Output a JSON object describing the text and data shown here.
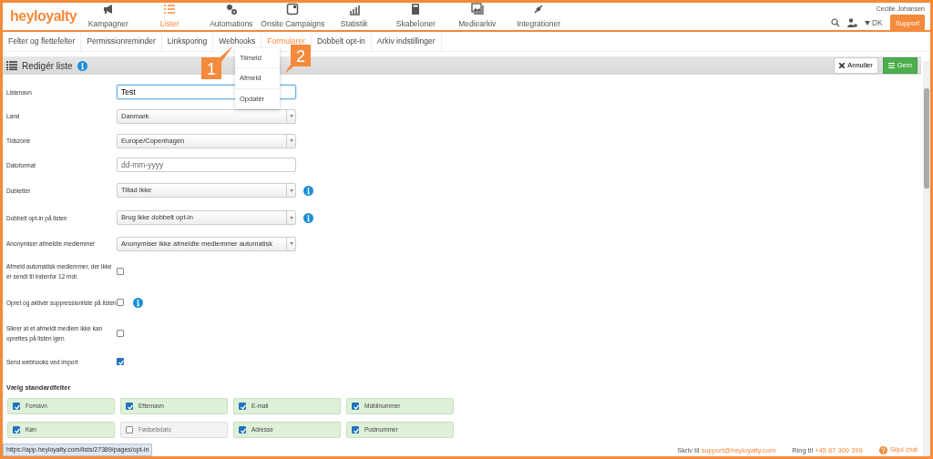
{
  "brand": "heyloyalty",
  "nav": [
    {
      "label": "Kampagner",
      "selected": false
    },
    {
      "label": "Lister",
      "selected": true
    },
    {
      "label": "Automations",
      "selected": false
    },
    {
      "label": "Onsite Campaigns",
      "selected": false
    },
    {
      "label": "Statistik",
      "selected": false
    },
    {
      "label": "Skabeloner",
      "selected": false
    },
    {
      "label": "Mediearkiv",
      "selected": false
    },
    {
      "label": "Integrationer",
      "selected": false
    }
  ],
  "user": {
    "name": "Cecilie Johansen",
    "language": "DK",
    "support": "Support"
  },
  "subnav": [
    {
      "label": "Felter og flettefelter",
      "selected": false
    },
    {
      "label": "Permissionreminder",
      "selected": false
    },
    {
      "label": "Linksporing",
      "selected": false
    },
    {
      "label": "Webhooks",
      "selected": false
    },
    {
      "label": "Formularer",
      "selected": true
    },
    {
      "label": "Dobbelt opt-in",
      "selected": false
    },
    {
      "label": "Arkiv indstillinger",
      "selected": false
    }
  ],
  "dropdown": [
    "Tilmeld",
    "Afmeld",
    "Opdatér"
  ],
  "callouts": [
    "1",
    "2"
  ],
  "panel": {
    "title": "Redigér liste",
    "cancel": "Annuller",
    "save": "Gem"
  },
  "form": [
    {
      "kind": "input",
      "label": "Listenavn",
      "value": "Test",
      "focused": true
    },
    {
      "kind": "select",
      "label": "Land",
      "value": "Danmark"
    },
    {
      "kind": "select",
      "label": "Tidszone",
      "value": "Europe/Copenhagen"
    },
    {
      "kind": "input",
      "label": "Datoformat",
      "placeholder": "dd-mm-yyyy",
      "focused": false
    },
    {
      "kind": "select",
      "label": "Dubletter",
      "value": "Tillad ikke",
      "info": true
    },
    {
      "kind": "select",
      "label": "Dobbelt opt-in på listen",
      "value": "Brug ikke dobbelt opt-in",
      "info": true
    },
    {
      "kind": "select",
      "label": "Anonymiser afmeldte medlemmer",
      "value": "Anonymiser ikke afmeldte medlemmer automatisk"
    },
    {
      "kind": "checkbox",
      "label": "Afmeld automatisk medlemmer, der ikke er sendt til indenfor 12 mdr.",
      "checked": false
    },
    {
      "kind": "checkbox",
      "label": "Opret og aktivér suppressionliste på listen",
      "checked": false,
      "info": true
    },
    {
      "kind": "checkbox",
      "label": "Sikrer at et afmeldt medlem ikke kan oprettes på listen igen",
      "checked": false
    },
    {
      "kind": "checkbox",
      "label": "Send webhooks ved import",
      "checked": true
    }
  ],
  "standard_fields": {
    "title": "Vælg standardfelter",
    "items": [
      {
        "label": "Fornavn",
        "checked": true
      },
      {
        "label": "Efternavn",
        "checked": true
      },
      {
        "label": "E-mail",
        "checked": true
      },
      {
        "label": "Mobilnummer",
        "checked": true
      },
      {
        "label": "Køn",
        "checked": true
      },
      {
        "label": "Fødselsdato",
        "checked": false
      },
      {
        "label": "Adresse",
        "checked": true
      },
      {
        "label": "Postnummer",
        "checked": true
      }
    ]
  },
  "footer": {
    "write_prefix": "Skriv til",
    "email": "support@heyloyalty.com",
    "call_prefix": "Ring til",
    "phone": "+45 87 300 399",
    "chat": "Skjul chat"
  },
  "status_url": "https://app.heyloyalty.com/lists/27389/pages/opt-in"
}
